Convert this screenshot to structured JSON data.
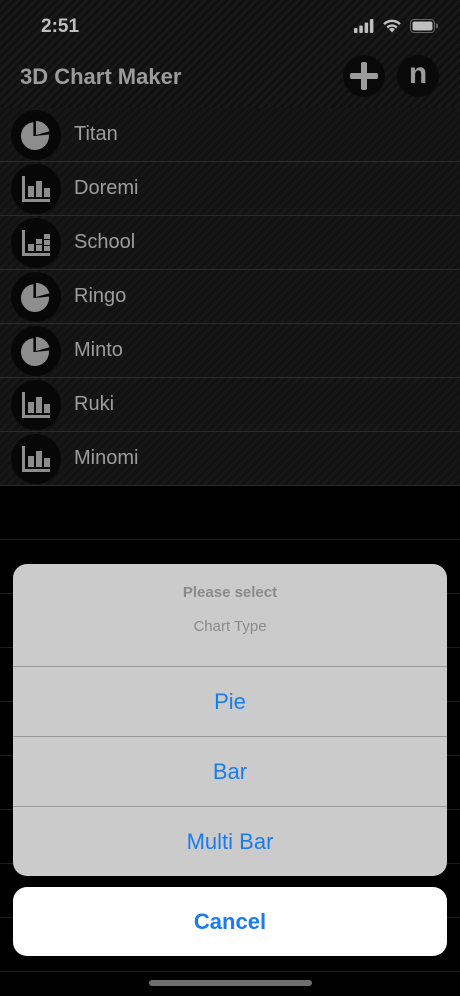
{
  "status_bar": {
    "time": "2:51"
  },
  "nav": {
    "title": "3D Chart Maker",
    "add_icon": "plus-icon",
    "n_label": "n"
  },
  "charts": [
    {
      "name": "Titan",
      "icon": "pie-chart-icon"
    },
    {
      "name": "Doremi",
      "icon": "bar-chart-icon"
    },
    {
      "name": "School",
      "icon": "multi-bar-chart-icon"
    },
    {
      "name": "Ringo",
      "icon": "pie-chart-icon"
    },
    {
      "name": "Minto",
      "icon": "pie-chart-icon"
    },
    {
      "name": "Ruki",
      "icon": "bar-chart-icon"
    },
    {
      "name": "Minomi",
      "icon": "bar-chart-icon"
    }
  ],
  "action_sheet": {
    "title": "Please select",
    "message": "Chart Type",
    "options": [
      "Pie",
      "Bar",
      "Multi Bar"
    ],
    "cancel": "Cancel"
  },
  "colors": {
    "accent": "#1a7cf0",
    "sheet_bg": "#cbcbcb",
    "icon_gray": "#bdbdbd"
  }
}
